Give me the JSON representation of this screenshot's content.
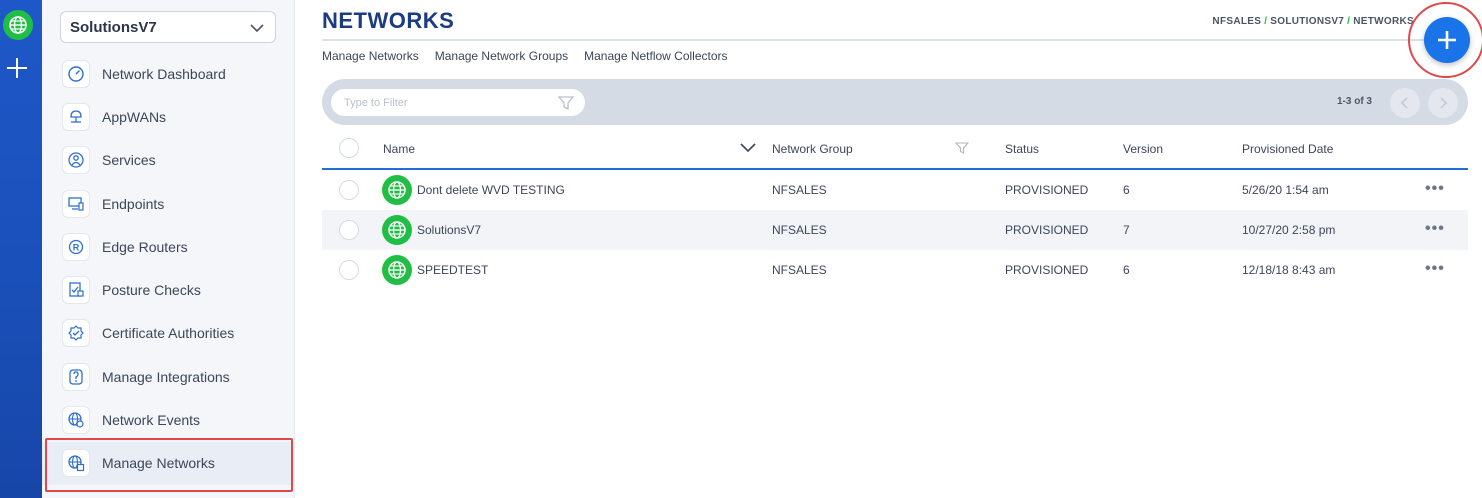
{
  "workspace": {
    "selected": "SolutionsV7"
  },
  "sidebar": {
    "items": [
      {
        "label": "Network Dashboard",
        "icon": "dashboard-icon"
      },
      {
        "label": "AppWANs",
        "icon": "appwan-icon"
      },
      {
        "label": "Services",
        "icon": "services-icon"
      },
      {
        "label": "Endpoints",
        "icon": "endpoints-icon"
      },
      {
        "label": "Edge Routers",
        "icon": "edge-router-icon"
      },
      {
        "label": "Posture Checks",
        "icon": "posture-check-icon"
      },
      {
        "label": "Certificate Authorities",
        "icon": "certificate-icon"
      },
      {
        "label": "Manage Integrations",
        "icon": "integrations-icon"
      },
      {
        "label": "Network Events",
        "icon": "network-events-icon"
      },
      {
        "label": "Manage Networks",
        "icon": "manage-networks-icon",
        "active": true
      }
    ]
  },
  "header": {
    "title": "NETWORKS",
    "breadcrumb": [
      "NFSALES",
      "SOLUTIONSV7",
      "NETWORKS"
    ],
    "breadcrumb_sep": "/"
  },
  "subnav": [
    "Manage Networks",
    "Manage Network Groups",
    "Manage Netflow Collectors"
  ],
  "filter": {
    "placeholder": "Type to Filter",
    "count": "1-3 of 3"
  },
  "table": {
    "columns": [
      "Name",
      "Network Group",
      "Status",
      "Version",
      "Provisioned Date"
    ],
    "rows": [
      {
        "name": "Dont delete WVD TESTING",
        "group": "NFSALES",
        "status": "PROVISIONED",
        "version": "6",
        "date": "5/26/20 1:54 am",
        "more": "•••"
      },
      {
        "name": "SolutionsV7",
        "group": "NFSALES",
        "status": "PROVISIONED",
        "version": "7",
        "date": "10/27/20 2:58 pm",
        "more": "•••"
      },
      {
        "name": "SPEEDTEST",
        "group": "NFSALES",
        "status": "PROVISIONED",
        "version": "6",
        "date": "12/18/18 8:43 am",
        "more": "•••"
      }
    ]
  },
  "colors": {
    "accent": "#1a73e8",
    "brand_green": "#1fbf45",
    "highlight_red": "#e0484c",
    "title_navy": "#1b3c82"
  }
}
